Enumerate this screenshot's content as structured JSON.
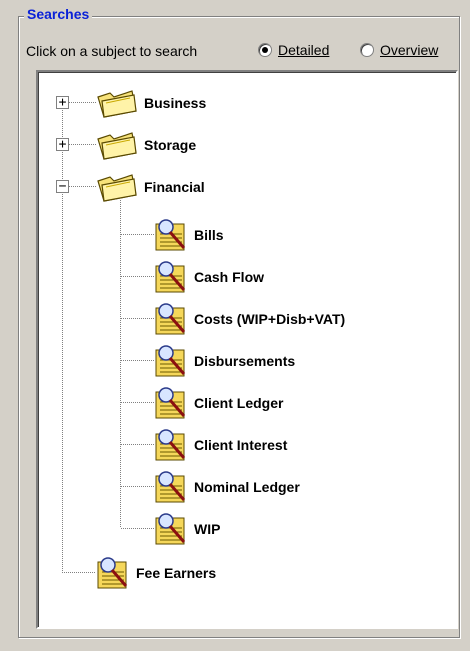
{
  "group": {
    "title": "Searches"
  },
  "options": {
    "prompt": "Click on a subject to search",
    "detailed": {
      "label": "Detailed",
      "checked": true
    },
    "overview": {
      "label": "Overview",
      "checked": false
    }
  },
  "tree": {
    "folders": [
      {
        "label": "Business",
        "expander": "+",
        "icon": "folder-icon"
      },
      {
        "label": "Storage",
        "expander": "+",
        "icon": "folder-icon"
      },
      {
        "label": "Financial",
        "expander": "−",
        "icon": "folder-open-icon"
      }
    ],
    "financial_children": [
      {
        "label": "Bills",
        "icon": "search-report-icon"
      },
      {
        "label": "Cash Flow",
        "icon": "search-report-icon"
      },
      {
        "label": "Costs (WIP+Disb+VAT)",
        "icon": "search-report-icon"
      },
      {
        "label": "Disbursements",
        "icon": "search-report-icon"
      },
      {
        "label": "Client Ledger",
        "icon": "search-report-icon"
      },
      {
        "label": "Client Interest",
        "icon": "search-report-icon"
      },
      {
        "label": "Nominal Ledger",
        "icon": "search-report-icon"
      },
      {
        "label": "WIP",
        "icon": "search-report-icon"
      }
    ],
    "fee_earners": {
      "label": "Fee Earners",
      "icon": "search-report-icon"
    }
  }
}
